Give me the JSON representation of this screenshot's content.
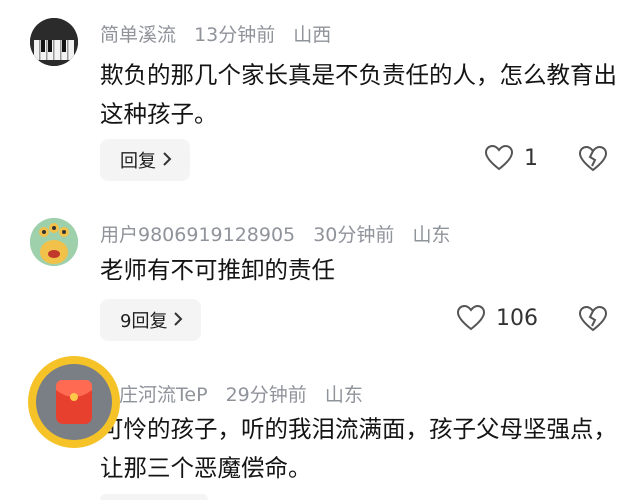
{
  "comments": [
    {
      "username": "简单溪流",
      "time": "13分钟前",
      "location": "山西",
      "text": "欺负的那几个家长真是不负责任的人，怎么教育出这种孩子。",
      "reply_label": "回复",
      "likes": "1"
    },
    {
      "username": "用户9806919128905",
      "time": "30分钟前",
      "location": "山东",
      "text": "老师有不可推卸的责任",
      "reply_label": "9回复",
      "likes": "106"
    },
    {
      "username": "鹈庄河流TeP",
      "time": "29分钟前",
      "location": "山东",
      "text": "可怜的孩子，听的我泪流满面，孩子父母坚强点，让那三个恶魔偿命。"
    }
  ],
  "icons": {
    "like": "heart-outline-icon",
    "dislike": "broken-heart-icon",
    "chevron": "chevron-right-icon"
  }
}
